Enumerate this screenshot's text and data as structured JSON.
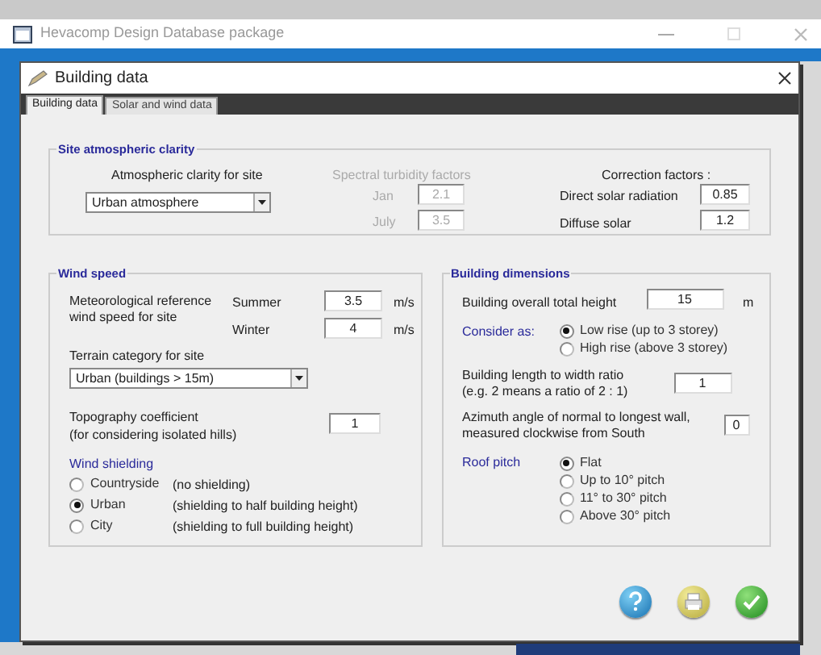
{
  "app_window": {
    "title": "Hevacomp Design Database package"
  },
  "dialog": {
    "title": "Building data"
  },
  "tabs": [
    {
      "label": "Building data",
      "selected": true
    },
    {
      "label": "Solar and wind data",
      "selected": false
    }
  ],
  "site_clarity": {
    "title": "Site atmospheric clarity",
    "clarity_label": "Atmospheric clarity for site",
    "clarity_value": "Urban atmosphere",
    "turbidity": {
      "label": "Spectral turbidity factors",
      "disabled": true,
      "fields": [
        {
          "label": "Jan",
          "value": "2.1"
        },
        {
          "label": "July",
          "value": "3.5"
        }
      ]
    },
    "correction": {
      "label": "Correction factors :",
      "fields": [
        {
          "label": "Direct solar radiation",
          "value": "0.85"
        },
        {
          "label": "Diffuse solar",
          "value": "1.2"
        }
      ]
    }
  },
  "wind_speed": {
    "title": "Wind speed",
    "reference_label": "Meteorological reference wind speed for site",
    "speeds": [
      {
        "label": "Summer",
        "value": "3.5",
        "unit": "m/s"
      },
      {
        "label": "Winter",
        "value": "4",
        "unit": "m/s"
      }
    ],
    "terrain_label": "Terrain category for site",
    "terrain_value": "Urban (buildings > 15m)",
    "topography_label": "Topography coefficient",
    "topography_note": "(for considering isolated hills)",
    "topography_value": "1",
    "shielding_label": "Wind shielding",
    "shielding": [
      {
        "label": "Countryside",
        "note": "(no shielding)",
        "selected": false
      },
      {
        "label": "Urban",
        "note": "(shielding to half building height)",
        "selected": true
      },
      {
        "label": "City",
        "note": "(shielding to full building height)",
        "selected": false
      }
    ]
  },
  "building_dimensions": {
    "title": "Building dimensions",
    "height_label": "Building overall total height",
    "height_value": "15",
    "height_unit": "m",
    "consider_label": "Consider as:",
    "consider": [
      {
        "label": "Low rise  (up to 3 storey)",
        "selected": true
      },
      {
        "label": "High rise  (above 3 storey)",
        "selected": false
      }
    ],
    "ratio_label": "Building length to width ratio",
    "ratio_note": "(e.g. 2 means a ratio of 2 : 1)",
    "ratio_value": "1",
    "azimuth_label": "Azimuth angle of normal to longest wall, measured clockwise from South",
    "azimuth_value": "0",
    "roof_label": "Roof pitch",
    "roof": [
      {
        "label": "Flat",
        "selected": true
      },
      {
        "label": "Up to 10° pitch",
        "selected": false
      },
      {
        "label": "11° to 30° pitch",
        "selected": false
      },
      {
        "label": "Above 30° pitch",
        "selected": false
      }
    ]
  },
  "buttons": [
    {
      "kind": "help"
    },
    {
      "kind": "print"
    },
    {
      "kind": "ok"
    }
  ]
}
